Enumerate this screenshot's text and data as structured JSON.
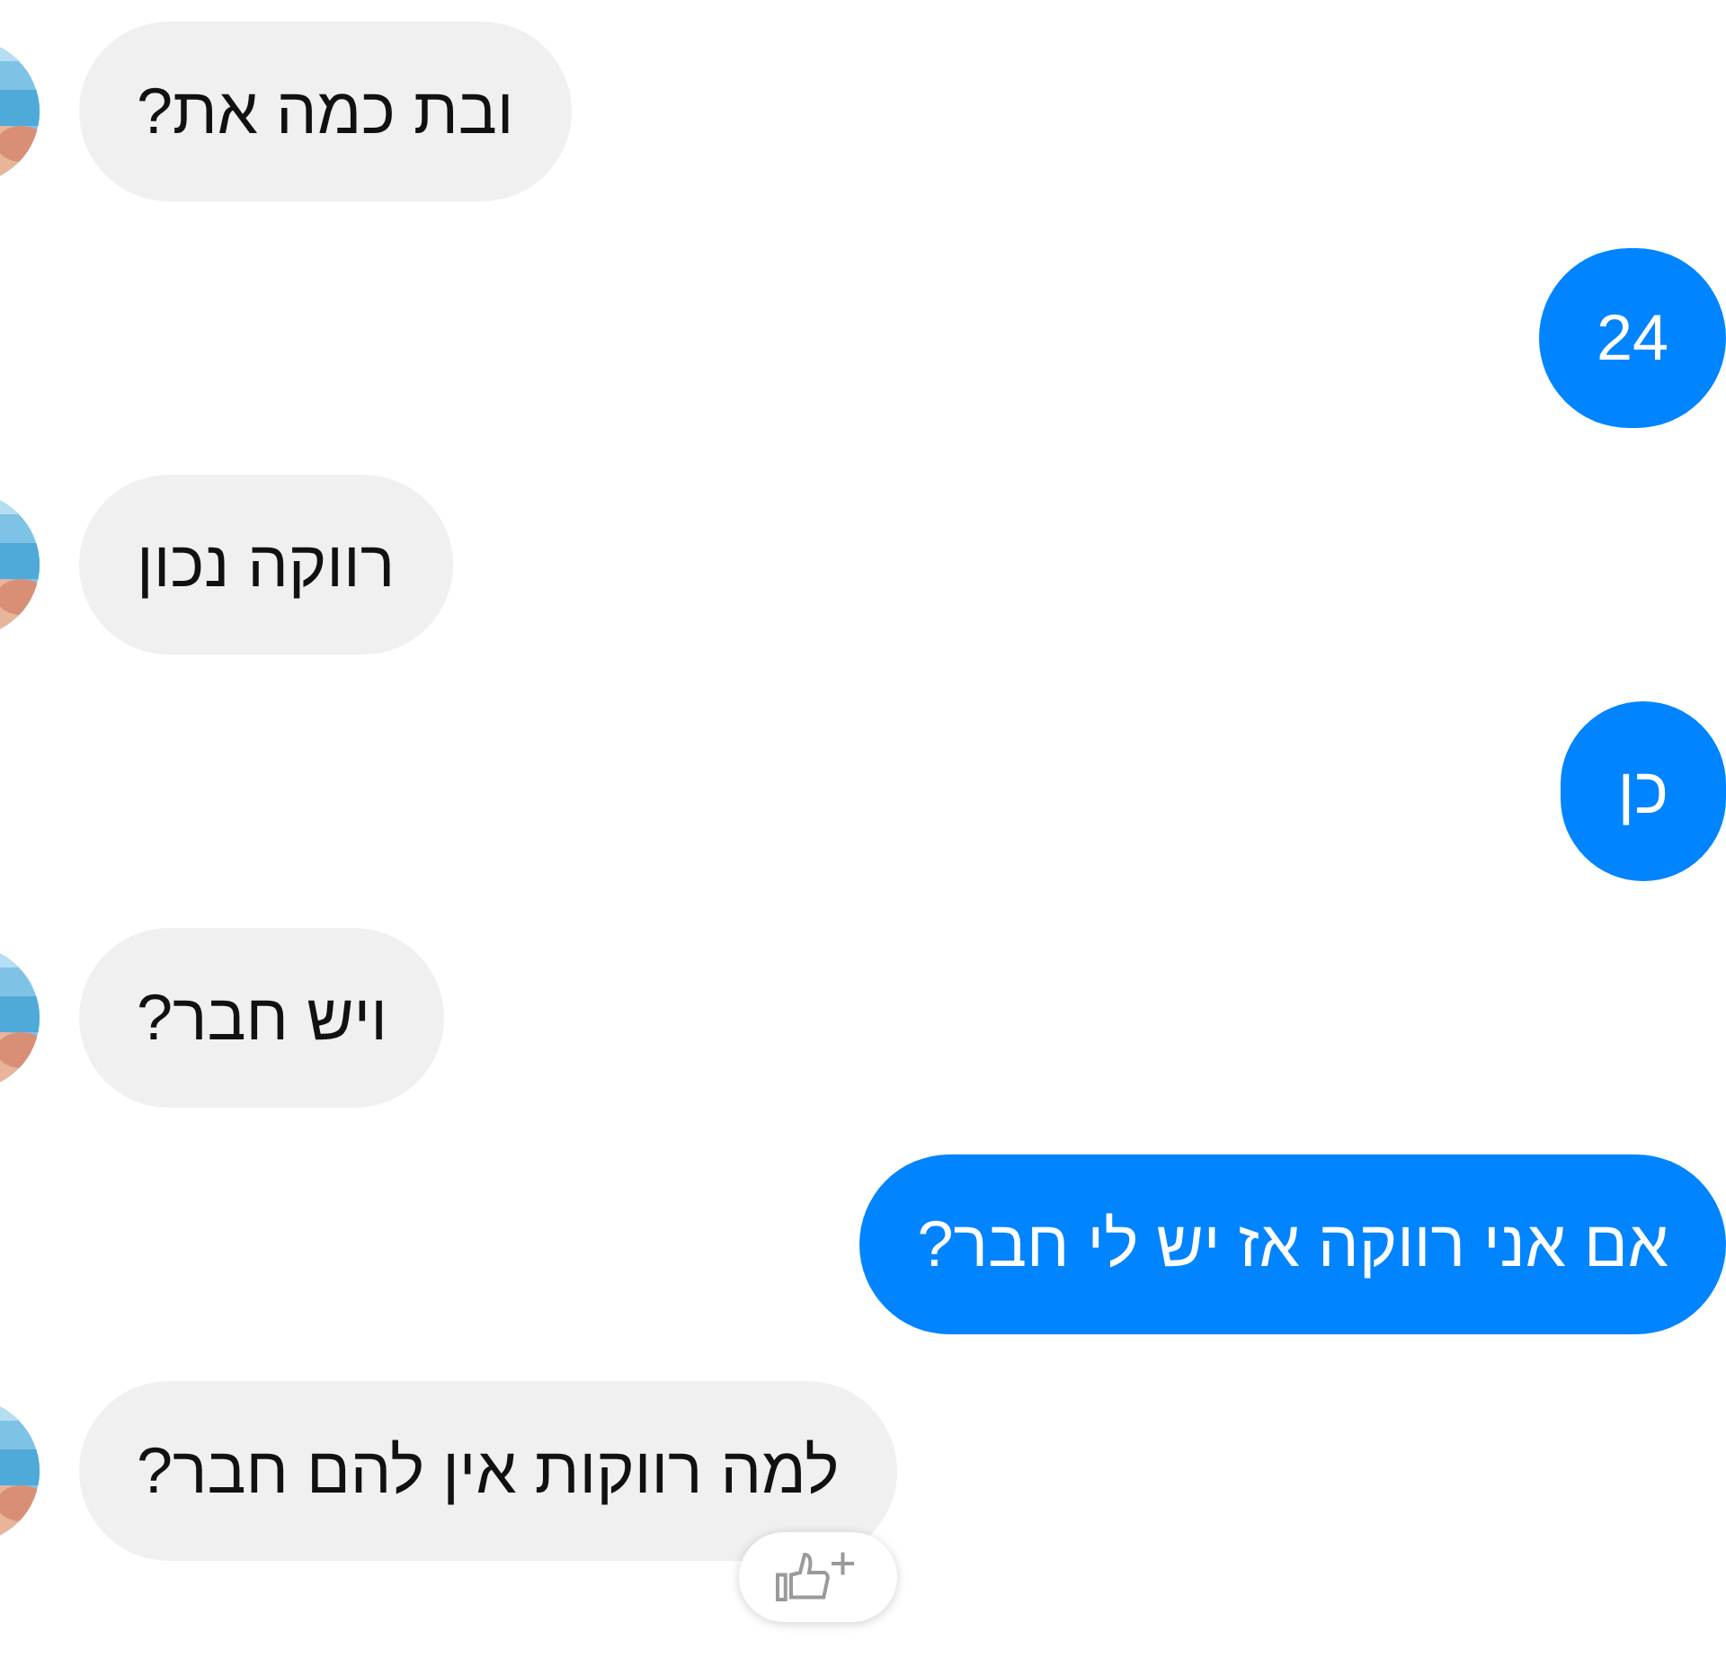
{
  "messages": [
    {
      "kind": "incoming",
      "text": "ובת כמה את?"
    },
    {
      "kind": "outgoing",
      "text": "24"
    },
    {
      "kind": "incoming",
      "text": "רווקה נכון"
    },
    {
      "kind": "outgoing",
      "text": "כן"
    },
    {
      "kind": "incoming",
      "text": "ויש חבר?"
    },
    {
      "kind": "outgoing",
      "text": "אם אני רווקה אז יש לי חבר?"
    },
    {
      "kind": "incoming",
      "text": "למה רווקות אין להם חבר?",
      "reaction_button": true
    }
  ]
}
